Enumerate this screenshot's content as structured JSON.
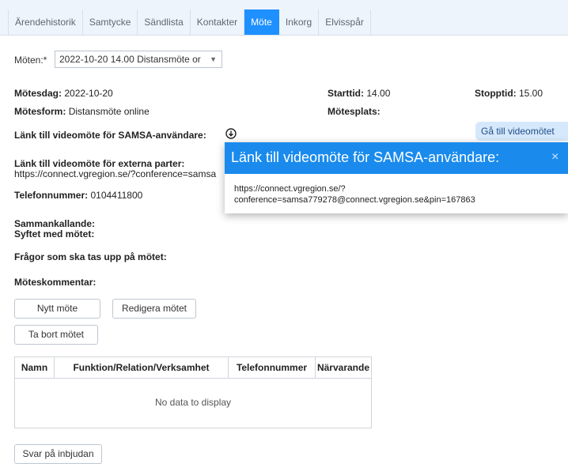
{
  "tabs": [
    "Ärendehistorik",
    "Samtycke",
    "Sändlista",
    "Kontakter",
    "Möte",
    "Inkorg",
    "Elvisspår"
  ],
  "active_tab": "Möte",
  "meeting_select": {
    "label": "Möten:*",
    "value": "2022-10-20 14.00 Distansmöte or",
    "arrow": "▼"
  },
  "details": {
    "motesdag_label": "Mötesdag:",
    "motesdag": "2022-10-20",
    "starttid_label": "Starttid:",
    "starttid": "14.00",
    "stopptid_label": "Stopptid:",
    "stopptid": "15.00",
    "motesform_label": "Mötesform:",
    "motesform": "Distansmöte online",
    "motesplats_label": "Mötesplats:",
    "lank_samsa_label": "Länk till videomöte för SAMSA-användare:",
    "goto_video": "Gå till videomötet",
    "lank_extern_label": "Länk till videomöte för externa parter:",
    "lank_extern": "https://connect.vgregion.se/?conference=samsa",
    "telefon_label": "Telefonnummer:",
    "telefon": "0104411800",
    "sammankallande_label": "Sammankallande:",
    "syfte_label": "Syftet med mötet:",
    "fragor_label": "Frågor som ska tas upp på mötet:",
    "kommentar_label": "Möteskommentar:"
  },
  "popup": {
    "title": "Länk till videomöte för SAMSA-användare:",
    "close": "×",
    "line1": "https://connect.vgregion.se/?",
    "line2": "conference=samsa779278@connect.vgregion.se&pin=167863"
  },
  "buttons": {
    "new": "Nytt möte",
    "edit": "Redigera mötet",
    "delete": "Ta bort mötet",
    "reply": "Svar på inbjudan"
  },
  "table": {
    "columns": [
      "Namn",
      "Funktion/Relation/Verksamhet",
      "Telefonnummer",
      "Närvarande"
    ],
    "empty_text": "No data to display"
  },
  "colors": {
    "accent": "#1e90ff",
    "popup_header": "#1a8bed",
    "tabbar_bg": "#eef4fb"
  }
}
